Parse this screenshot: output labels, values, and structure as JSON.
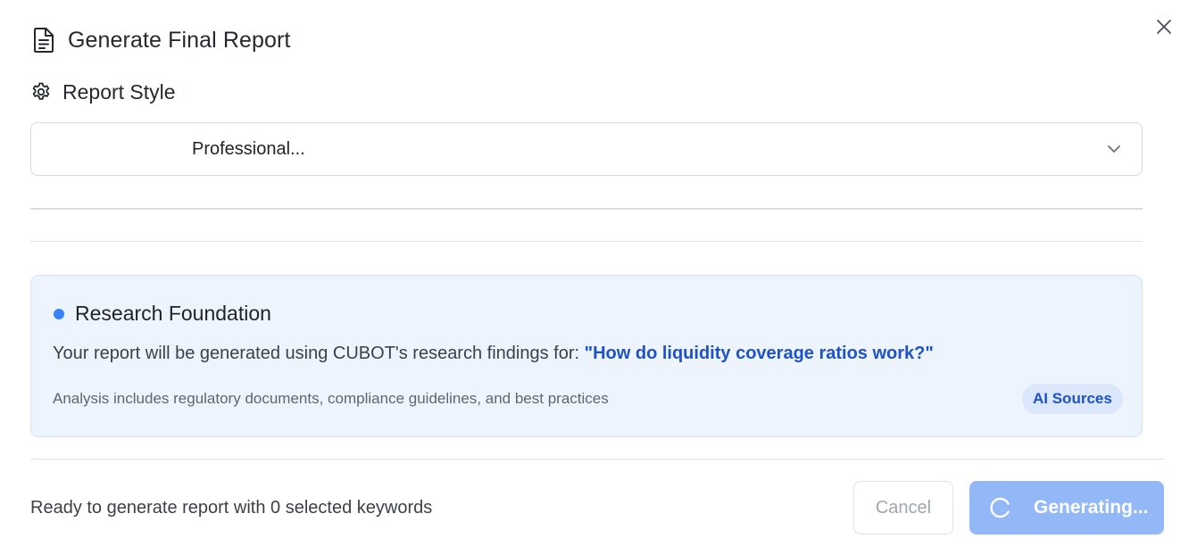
{
  "dialog": {
    "title": "Generate Final Report",
    "title_icon": "document-icon",
    "close_icon": "close-icon"
  },
  "report_style": {
    "section_label": "Report Style",
    "section_icon": "gear-icon",
    "selected_value": "Professional..."
  },
  "research_foundation": {
    "title": "Research Foundation",
    "description_prefix": "Your report will be generated using CUBOT's research findings for: ",
    "query": "\"How do liquidity coverage ratios work?\"",
    "note": "Analysis includes regulatory documents, compliance guidelines, and best practices",
    "badge": "AI Sources",
    "accent_color": "#3b82f6"
  },
  "footer": {
    "status_text": "Ready to generate report with 0 selected keywords",
    "cancel_label": "Cancel",
    "generate_label": "Generating...",
    "generate_color": "#93b8f7"
  }
}
